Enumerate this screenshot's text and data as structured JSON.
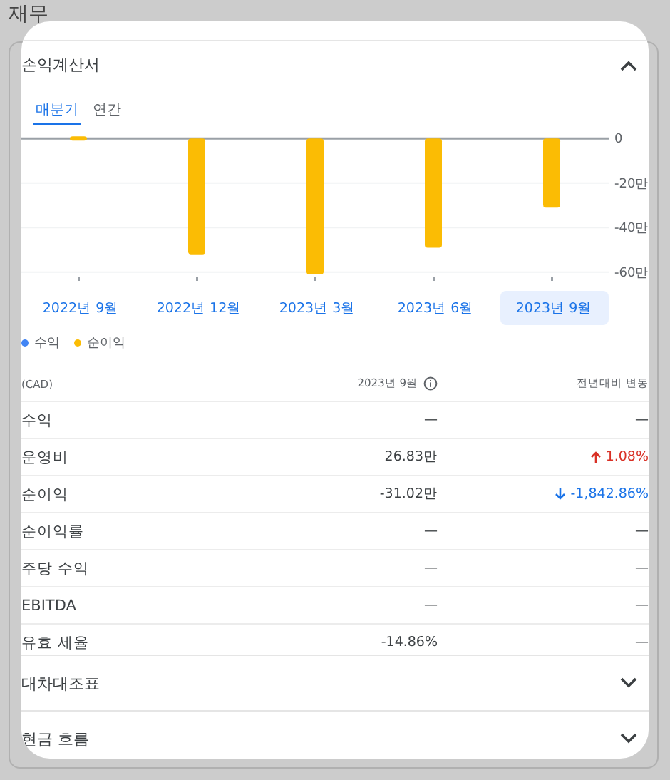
{
  "page_title": "재무",
  "sections": [
    {
      "title": "손익계산서",
      "expanded": true
    },
    {
      "title": "대차대조표",
      "expanded": false
    },
    {
      "title": "현금 흐름",
      "expanded": false
    }
  ],
  "tabs": [
    {
      "label": "매분기",
      "selected": true
    },
    {
      "label": "연간",
      "selected": false
    }
  ],
  "chart_data": {
    "type": "bar",
    "categories": [
      "2022년 9월",
      "2022년 12월",
      "2023년 3월",
      "2023년 6월",
      "2023년 9월"
    ],
    "series": [
      {
        "name": "수익",
        "color": "#4285f4",
        "values": [
          null,
          null,
          null,
          null,
          null
        ]
      },
      {
        "name": "순이익",
        "color": "#fbbc04",
        "values": [
          1,
          -52,
          -61,
          -49,
          -31
        ]
      }
    ],
    "ylim": [
      -62,
      2
    ],
    "grid": true,
    "yticks": [
      {
        "value": 0,
        "label": "0"
      },
      {
        "value": -20,
        "label": "-20만"
      },
      {
        "value": -40,
        "label": "-40만"
      },
      {
        "value": -60,
        "label": "-60만"
      }
    ]
  },
  "period_buttons": [
    {
      "selected": false
    },
    {
      "selected": false
    },
    {
      "selected": false
    },
    {
      "selected": false
    },
    {
      "selected": true
    }
  ],
  "table": {
    "columns": [
      "(CAD)",
      "2023년 9월",
      "전년대비 변동"
    ],
    "rows": [
      {
        "label": "수익",
        "value": "—",
        "change": "—",
        "kind": "none"
      },
      {
        "label": "운영비",
        "value": "26.83만",
        "change": "1.08%",
        "kind": "up"
      },
      {
        "label": "순이익",
        "value": "-31.02만",
        "change": "-1,842.86%",
        "kind": "down"
      },
      {
        "label": "순이익률",
        "value": "—",
        "change": "—",
        "kind": "none"
      },
      {
        "label": "주당 수익",
        "value": "—",
        "change": "—",
        "kind": "none"
      },
      {
        "label": "EBITDA",
        "value": "—",
        "change": "—",
        "kind": "none"
      },
      {
        "label": "유효 세율",
        "value": "-14.86%",
        "change": "—",
        "kind": "none"
      }
    ]
  }
}
